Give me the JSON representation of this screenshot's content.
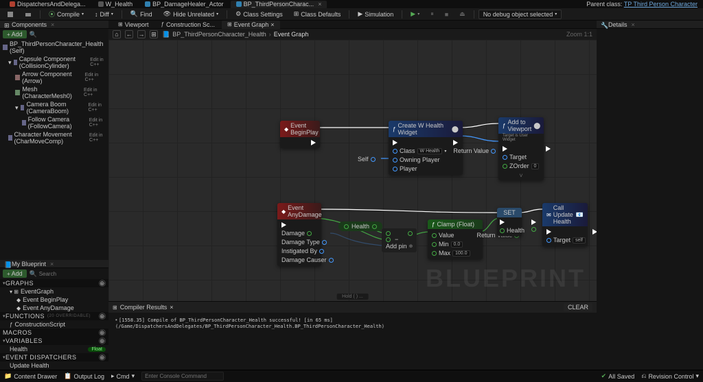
{
  "topTabs": [
    {
      "label": "DispatchersAndDelega..."
    },
    {
      "label": "W_Health"
    },
    {
      "label": "BP_DamageHealer_Actor"
    },
    {
      "label": "BP_ThirdPersonCharac..."
    }
  ],
  "parentClass": {
    "prefix": "Parent class: ",
    "link": "TP Third Person Character"
  },
  "toolbar": {
    "compile": "Compile",
    "diff": "Diff",
    "find": "Find",
    "hideUnrelated": "Hide Unrelated",
    "classSettings": "Class Settings",
    "classDefaults": "Class Defaults",
    "simulation": "Simulation",
    "noDebug": "No debug object selected"
  },
  "componentsPanel": {
    "title": "Components",
    "add": "Add",
    "searchPlaceholder": "",
    "items": [
      {
        "label": "BP_ThirdPersonCharacter_Health (Self)",
        "indent": 0
      },
      {
        "label": "Capsule Component (CollisionCylinder)",
        "cpp": "Edit in C++",
        "indent": 1
      },
      {
        "label": "Arrow Component (Arrow)",
        "cpp": "Edit in C++",
        "indent": 2
      },
      {
        "label": "Mesh (CharacterMesh0)",
        "cpp": "Edit in C++",
        "indent": 2
      },
      {
        "label": "Camera Boom (CameraBoom)",
        "cpp": "Edit in C++",
        "indent": 2
      },
      {
        "label": "Follow Camera (FollowCamera)",
        "cpp": "Edit in C++",
        "indent": 3
      },
      {
        "label": "Character Movement (CharMoveComp)",
        "cpp": "Edit in C++",
        "indent": 1
      }
    ]
  },
  "myBlueprint": {
    "title": "My Blueprint",
    "add": "Add",
    "searchPlaceholder": "Search",
    "sections": {
      "graphs": "GRAPHS",
      "functions": "FUNCTIONS",
      "macros": "MACROS",
      "variables": "VARIABLES",
      "dispatchers": "EVENT DISPATCHERS"
    },
    "graphs": [
      {
        "label": "EventGraph",
        "kids": [
          {
            "label": "Event BeginPlay"
          },
          {
            "label": "Event AnyDamage"
          }
        ]
      }
    ],
    "functions": [
      {
        "label": "ConstructionScript"
      }
    ],
    "functionsSub": "(20 OVERRIDABLE)",
    "variables": [
      {
        "label": "Health",
        "type": "Float"
      }
    ],
    "dispatchers": [
      {
        "label": "Update Health"
      }
    ]
  },
  "graphTabs": [
    {
      "label": "Viewport"
    },
    {
      "label": "Construction Sc..."
    },
    {
      "label": "Event Graph"
    }
  ],
  "breadcrumb": {
    "root": "BP_ThirdPersonCharacter_Health",
    "leaf": "Event Graph"
  },
  "zoom": "Zoom 1:1",
  "nodes": {
    "beginPlay": {
      "title": "Event BeginPlay"
    },
    "createWidget": {
      "title": "Create W Health Widget",
      "pins": {
        "class": "Class",
        "classVal": "W Health",
        "owningPlayer": "Owning Player",
        "player": "Player",
        "returnValue": "Return Value"
      }
    },
    "addViewport": {
      "title": "Add to Viewport",
      "sub": "Target is User Widget",
      "pins": {
        "target": "Target",
        "zorder": "ZOrder",
        "zorderVal": "0"
      }
    },
    "selfRef": "Self",
    "anyDamage": {
      "title": "Event AnyDamage",
      "pins": {
        "damage": "Damage",
        "damageType": "Damage Type",
        "instigatedBy": "Instigated By",
        "damageCauser": "Damage Causer"
      }
    },
    "healthVar": "Health",
    "subtract": {
      "addPin": "Add pin"
    },
    "clamp": {
      "title": "Clamp (Float)",
      "pins": {
        "value": "Value",
        "min": "Min",
        "minVal": "0.0",
        "max": "Max",
        "maxVal": "100.0",
        "returnValue": "Return Value"
      }
    },
    "set": {
      "title": "SET",
      "pins": {
        "health": "Health"
      }
    },
    "callUpdate": {
      "title": "Call Update Health",
      "pins": {
        "target": "Target",
        "targetVal": "self"
      }
    }
  },
  "watermark": "BLUEPRINT",
  "canvasHint": "Hold (  ) ...",
  "compiler": {
    "tab": "Compiler Results",
    "msg": "[1558.35] Compile of BP_ThirdPersonCharacter_Health successful! [in 65 ms] (/Game/DispatchersAndDelegates/BP_ThirdPersonCharacter_Health.BP_ThirdPersonCharacter_Health)"
  },
  "details": {
    "title": "Details"
  },
  "status": {
    "contentDrawer": "Content Drawer",
    "outputLog": "Output Log",
    "cmd": "Cmd",
    "cmdPlaceholder": "Enter Console Command",
    "allSaved": "All Saved",
    "revision": "Revision Control"
  },
  "compilerClear": "CLEAR"
}
